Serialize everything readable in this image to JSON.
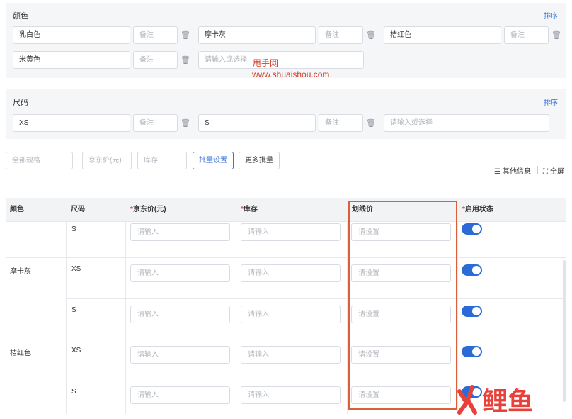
{
  "color_section": {
    "title": "颜色",
    "sort_label": "排序",
    "rows": [
      [
        {
          "value": "乳白色",
          "note_placeholder": "备注"
        },
        {
          "value": "摩卡灰",
          "note_placeholder": "备注"
        },
        {
          "value": "桔红色",
          "note_placeholder": "备注"
        }
      ],
      [
        {
          "value": "米黄色",
          "note_placeholder": "备注"
        }
      ]
    ],
    "new_placeholder": "请输入或选择"
  },
  "size_section": {
    "title": "尺码",
    "sort_label": "排序",
    "items": [
      {
        "value": "XS",
        "note_placeholder": "备注"
      },
      {
        "value": "S",
        "note_placeholder": "备注"
      }
    ],
    "new_placeholder": "请输入或选择"
  },
  "toolbar": {
    "all_specs_placeholder": "全部规格",
    "jd_price_placeholder": "京东价(元)",
    "stock_placeholder": "库存",
    "batch_set_label": "批量设置",
    "more_batch_label": "更多批量",
    "other_info_label": "其他信息",
    "fullscreen_label": "全屏"
  },
  "table": {
    "headers": {
      "color": "颜色",
      "size": "尺码",
      "jd_price": "京东价(元)",
      "stock": "库存",
      "strike_price": "划线价",
      "status": "启用状态"
    },
    "required_mark": "*",
    "input_placeholder": "请输入",
    "strike_placeholder": "请设置",
    "rows": [
      {
        "color": "",
        "size": "S",
        "enabled": true
      },
      {
        "color": "摩卡灰",
        "size": "XS",
        "enabled": true
      },
      {
        "color": "",
        "size": "S",
        "enabled": true
      },
      {
        "color": "桔红色",
        "size": "XS",
        "enabled": true
      },
      {
        "color": "",
        "size": "S",
        "enabled": true
      }
    ],
    "accent_color": "#2a6bd8",
    "highlight_color": "#d9603a"
  },
  "watermark": {
    "line1": "甩手网",
    "line2": "www.shuaishou.com",
    "logo_text": "鲤鱼"
  }
}
